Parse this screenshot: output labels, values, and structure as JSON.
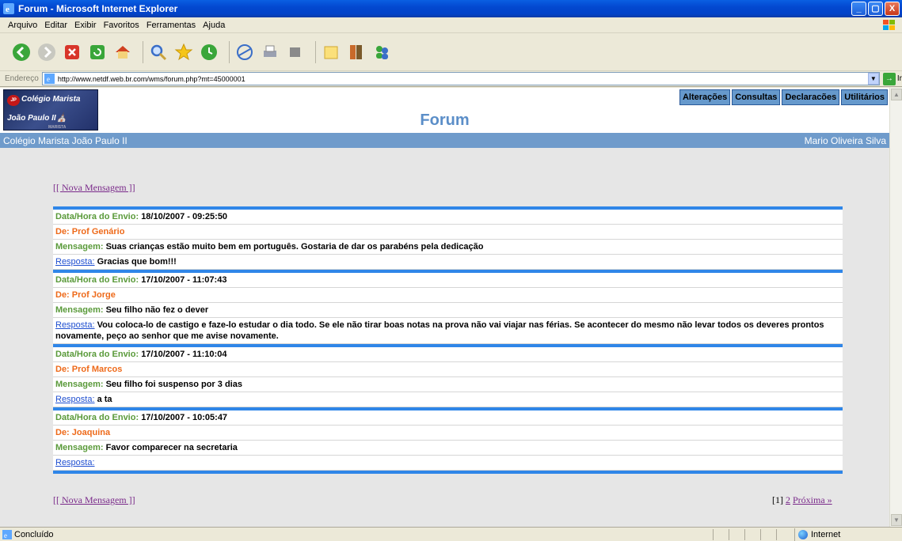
{
  "window": {
    "title": "Forum - Microsoft Internet Explorer",
    "controls": [
      "_",
      "▢",
      "X"
    ]
  },
  "menu": [
    "Arquivo",
    "Editar",
    "Exibir",
    "Favoritos",
    "Ferramentas",
    "Ajuda"
  ],
  "address": {
    "label": "Endereço",
    "url": "http://www.netdf.web.br.com/wms/forum.php?mt=45000001",
    "go_label": "Ir"
  },
  "site": {
    "logo_line1": "Colégio Marista",
    "logo_line2": "João Paulo II",
    "logo_line3": "MARISTA",
    "logo_crest": "JP",
    "nav": [
      "Alterações",
      "Consultas",
      "Declaracões",
      "Utilitários"
    ],
    "page_title": "Forum",
    "school_name": "Colégio Marista João Paulo II",
    "user_name": "Mario Oliveira Silva"
  },
  "forum": {
    "new_message": "[[ Nova Mensagem ]]",
    "labels": {
      "date": "Data/Hora do Envio:",
      "from": "De:",
      "message": "Mensagem:",
      "reply": "Resposta:"
    },
    "messages": [
      {
        "date": "18/10/2007 - 09:25:50",
        "from": "Prof Genário",
        "message": "Suas crianças estão muito bem em português. Gostaria de dar os parabéns pela dedicação",
        "reply": "Gracias que bom!!!"
      },
      {
        "date": "17/10/2007 - 11:07:43",
        "from": "Prof Jorge",
        "message": "Seu filho não fez o dever",
        "reply": "Vou coloca-lo de castigo e faze-lo estudar o dia todo. Se ele não tirar boas notas na prova não vai viajar nas férias. Se acontecer do mesmo não levar todos os deveres prontos novamente, peço ao senhor que me avise novamente."
      },
      {
        "date": "17/10/2007 - 11:10:04",
        "from": "Prof Marcos",
        "message": "Seu filho foi suspenso por 3 dias",
        "reply": "a ta"
      },
      {
        "date": "17/10/2007 - 10:05:47",
        "from": "Joaquina",
        "message": "Favor comparecer na secretaria",
        "reply": ""
      }
    ],
    "pager": {
      "current": "[1]",
      "page2": "2",
      "next": "Próxima »"
    }
  },
  "status": {
    "text": "Concluído",
    "zone": "Internet"
  },
  "colors": {
    "titlebar": "#0348d0",
    "accent_blue": "#2f86e8",
    "label_green": "#5a9a3a",
    "label_orange": "#ee6a1a",
    "nav_bg": "#6699cc",
    "subbar_bg": "#6f9bcb"
  },
  "icons": [
    "ie-icon",
    "back-icon",
    "forward-icon",
    "stop-icon",
    "refresh-icon",
    "home-icon",
    "search-icon",
    "favorites-icon",
    "history-icon",
    "mail-icon",
    "print-icon",
    "edit-icon",
    "folder-icon",
    "research-icon",
    "messenger-icon"
  ]
}
